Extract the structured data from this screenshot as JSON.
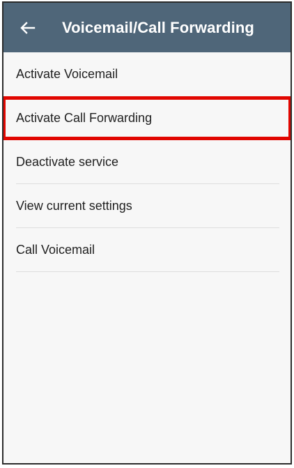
{
  "header": {
    "title": "Voicemail/Call Forwarding",
    "back_icon": "arrow-left-icon"
  },
  "menu": {
    "items": [
      {
        "label": "Activate Voicemail"
      },
      {
        "label": "Activate Call Forwarding"
      },
      {
        "label": "Deactivate service"
      },
      {
        "label": "View current settings"
      },
      {
        "label": "Call Voicemail"
      }
    ]
  },
  "colors": {
    "appbar": "#4f6679",
    "highlight": "#e10600",
    "background": "#f7f7f7"
  }
}
